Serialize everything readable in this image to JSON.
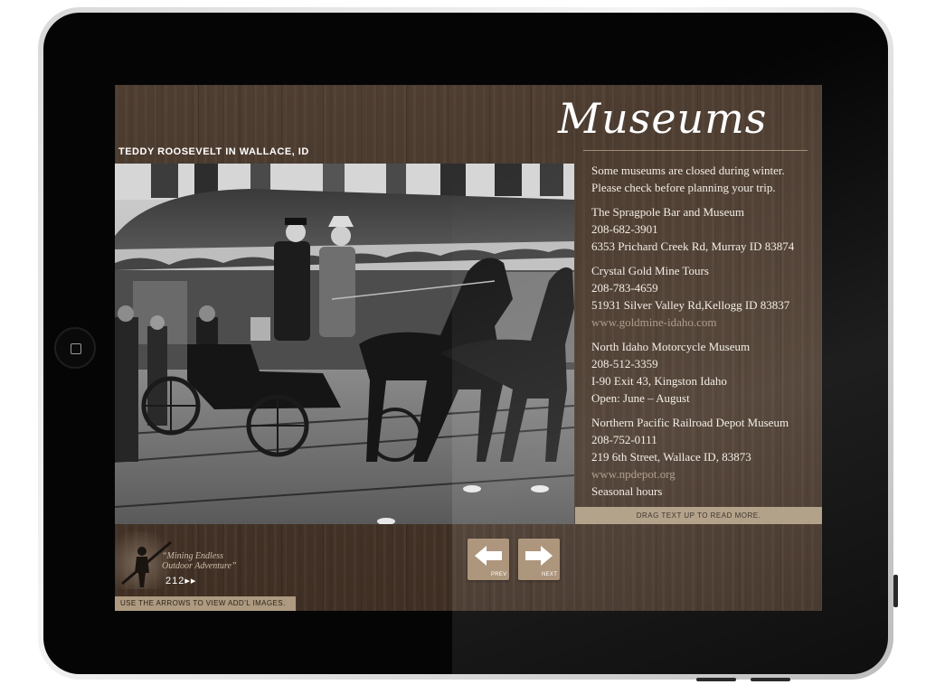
{
  "header": {
    "title": "Museums",
    "photo_caption": "TEDDY ROOSEVELT IN WALLACE, ID"
  },
  "info": {
    "intro": "Some museums are closed during winter. Please check before planning your trip.",
    "museums": [
      {
        "name": "The Spragpole Bar and Museum",
        "phone": "208-682-3901",
        "address": "6353 Prichard Creek Rd, Murray ID 83874"
      },
      {
        "name": "Crystal Gold Mine Tours",
        "phone": "208-783-4659",
        "address": "51931 Silver Valley Rd,Kellogg ID  83837",
        "url": "www.goldmine-idaho.com"
      },
      {
        "name": "North Idaho Motorcycle Museum",
        "phone": "208-512-3359",
        "address": "I-90 Exit 43, Kingston Idaho",
        "hours": "Open: June – August"
      },
      {
        "name": "Northern Pacific Railroad Depot Museum",
        "phone": "208-752-0111",
        "address": "219 6th Street, Wallace ID, 83873",
        "url": "www.npdepot.org",
        "hours": "Seasonal hours"
      }
    ]
  },
  "drag_hint": "DRAG TEXT UP TO READ MORE.",
  "nav": {
    "prev_label": "PREV",
    "next_label": "NEXT"
  },
  "footer": {
    "tagline_line1": "“Mining Endless",
    "tagline_line2": "Outdoor Adventure”",
    "page_number": "212▸▸",
    "arrows_hint": "USE THE ARROWS TO VIEW ADD’L IMAGES."
  },
  "colors": {
    "wood": "#4a392c",
    "accent_bar": "#ad9a80",
    "text": "#f2ece4",
    "url": "#a89683"
  }
}
